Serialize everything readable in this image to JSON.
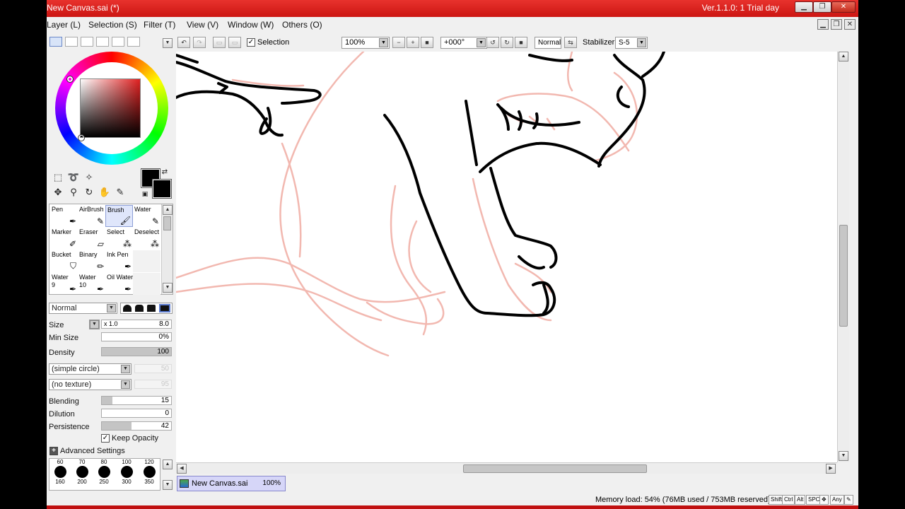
{
  "window": {
    "title": "New Canvas.sai (*)",
    "version": "Ver.1.1.0: 1 Trial day",
    "minimize": "▁",
    "maximize": "❐",
    "close": "✕"
  },
  "menu": [
    {
      "label": "Layer (L)"
    },
    {
      "label": "Selection (S)"
    },
    {
      "label": "Filter (T)"
    },
    {
      "label": "View (V)"
    },
    {
      "label": "Window (W)"
    },
    {
      "label": "Others (O)"
    }
  ],
  "toolbar": {
    "selection_label": "Selection",
    "selection_checked": true,
    "zoom": "100%",
    "rotation": "+000°",
    "blend_mode": "Normal",
    "stabilizer_label": "Stabilizer",
    "stabilizer_value": "S-5"
  },
  "tools": {
    "brushes": [
      {
        "label": "Pen",
        "sub": ""
      },
      {
        "label": "AirBrush",
        "sub": ""
      },
      {
        "label": "Brush",
        "sub": ""
      },
      {
        "label": "Water",
        "sub": ""
      },
      {
        "label": "Marker",
        "sub": ""
      },
      {
        "label": "Eraser",
        "sub": ""
      },
      {
        "label": "Select",
        "sub": ""
      },
      {
        "label": "Deselect",
        "sub": ""
      },
      {
        "label": "Bucket",
        "sub": ""
      },
      {
        "label": "Binary",
        "sub": ""
      },
      {
        "label": "Ink Pen",
        "sub": ""
      },
      {
        "label": "",
        "sub": ""
      },
      {
        "label": "Water",
        "sub": "9"
      },
      {
        "label": "Water",
        "sub": "10"
      },
      {
        "label": "Oil Water",
        "sub": ""
      },
      {
        "label": "",
        "sub": ""
      }
    ],
    "selected_brush": "Brush"
  },
  "brush_settings": {
    "blend_mode": "Normal",
    "size_label": "Size",
    "size_multiplier": "x 1.0",
    "size_value": "8.0",
    "min_size_label": "Min Size",
    "min_size_value": "0%",
    "density_label": "Density",
    "density_value": "100",
    "shape": "(simple circle)",
    "shape_value": "50",
    "texture": "(no texture)",
    "texture_value": "95",
    "blending_label": "Blending",
    "blending_value": "15",
    "dilution_label": "Dilution",
    "dilution_value": "0",
    "persistence_label": "Persistence",
    "persistence_value": "42",
    "keep_opacity_label": "Keep Opacity",
    "keep_opacity_checked": true,
    "advanced_label": "Advanced Settings"
  },
  "size_presets": [
    {
      "top": "60",
      "bottom": "160"
    },
    {
      "top": "70",
      "bottom": "200"
    },
    {
      "top": "80",
      "bottom": "250"
    },
    {
      "top": "100",
      "bottom": "300"
    },
    {
      "top": "120",
      "bottom": "350"
    }
  ],
  "navigator": {
    "name": "New Canvas.sai",
    "zoom": "100%"
  },
  "status": {
    "memory": "Memory load: 54% (76MB used / 753MB reserved)",
    "keys": [
      "Shift",
      "Ctrl",
      "Alt",
      "SPC",
      "Any"
    ]
  },
  "colors": {
    "title_bar": "#d9201c",
    "primary": "#000000",
    "secondary": "#000000",
    "sketch_line": "#f2b8b0",
    "ink_line": "#000000"
  }
}
